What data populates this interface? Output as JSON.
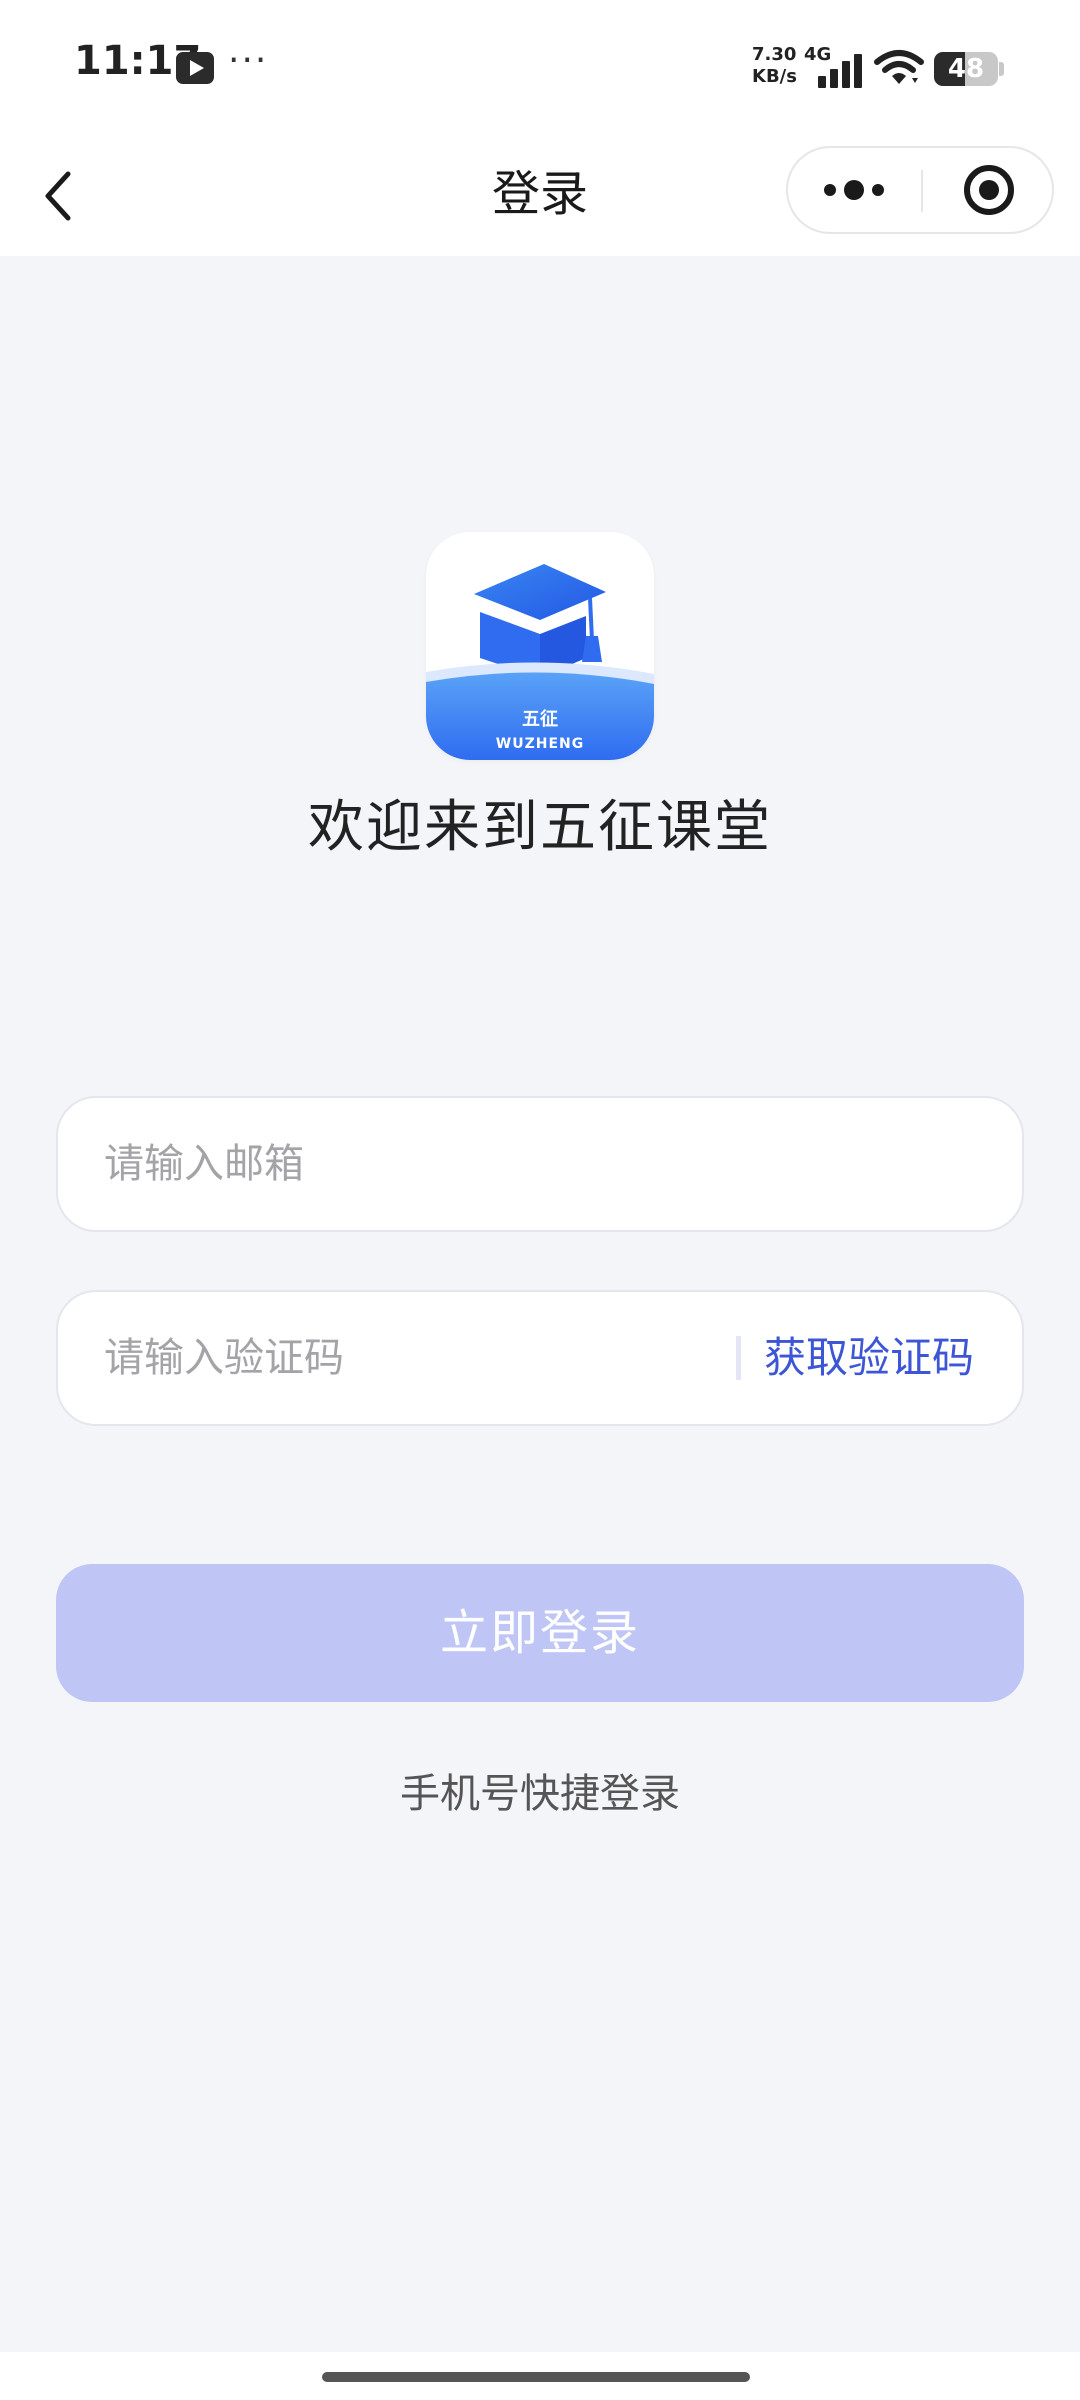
{
  "status_bar": {
    "time": "11:17",
    "more_dots": "···",
    "net_speed_value": "7.30",
    "net_speed_unit": "KB/s",
    "network_type": "4G",
    "battery_level": "48",
    "icons": [
      "video-app-icon",
      "signal-icon",
      "wifi-icon",
      "battery-icon"
    ]
  },
  "nav": {
    "title": "登录",
    "back_icon": "chevron-left-icon",
    "more_icon": "more-dots-icon",
    "close_icon": "target-close-icon"
  },
  "brand": {
    "logo_text_cn": "五征",
    "logo_text_en": "WUZHENG",
    "welcome": "欢迎来到五征课堂",
    "colors": {
      "primary": "#3d56d6",
      "logo_blue": "#2f6cf0",
      "button_disabled": "#bfc6f6",
      "background": "#f4f5f9"
    }
  },
  "form": {
    "email_placeholder": "请输入邮箱",
    "email_value": "",
    "code_placeholder": "请输入验证码",
    "code_value": "",
    "get_code_label": "获取验证码",
    "login_label": "立即登录",
    "phone_login_label": "手机号快捷登录"
  }
}
